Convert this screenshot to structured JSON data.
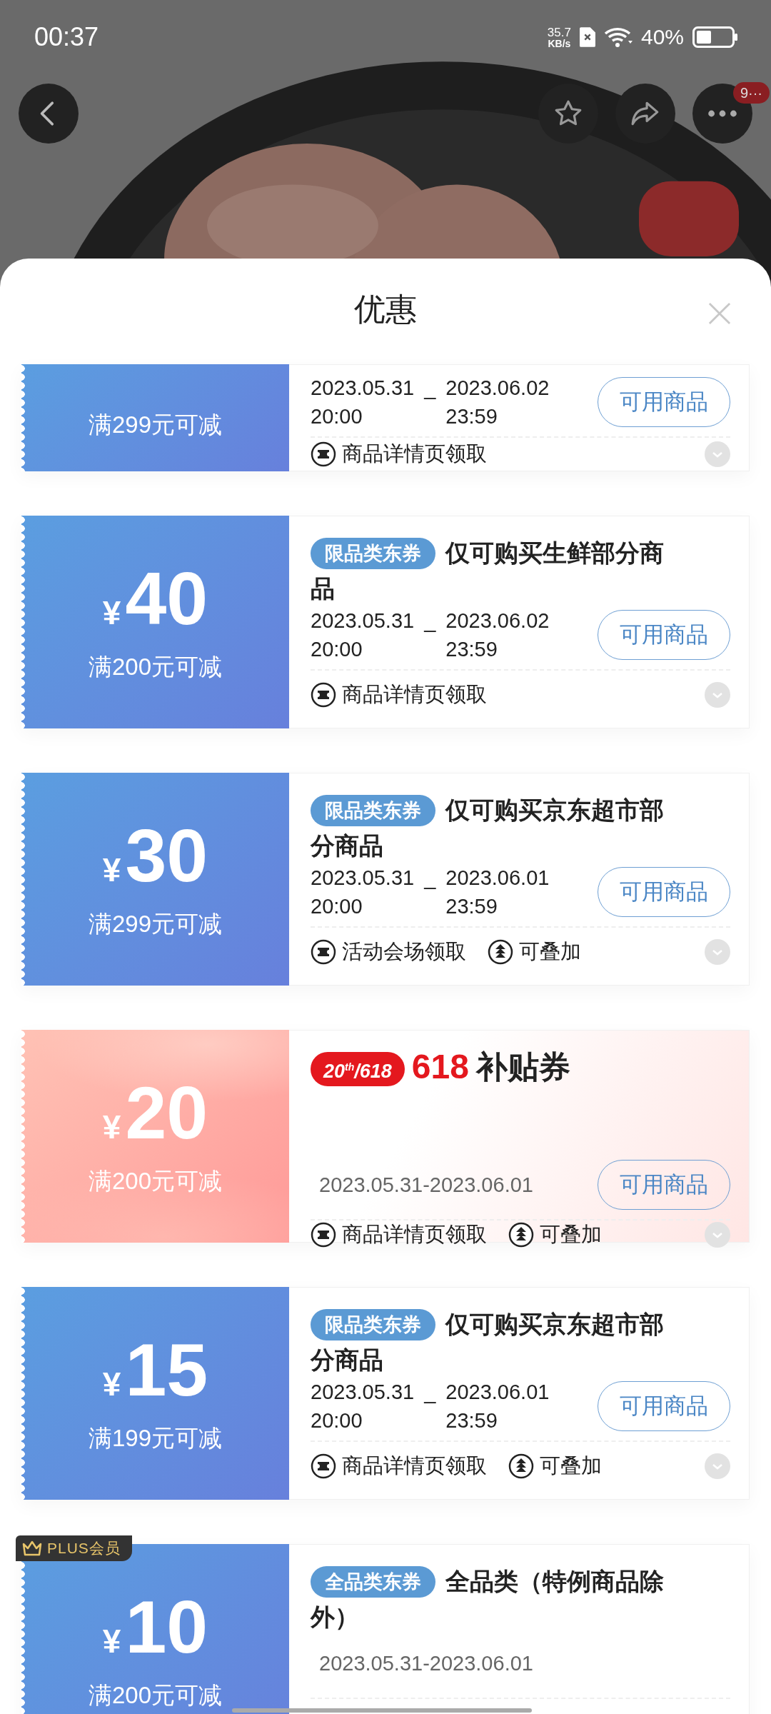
{
  "status_bar": {
    "time": "00:37",
    "net_speed": "35.7",
    "net_unit": "KB/s",
    "battery": "40%"
  },
  "top_bar": {
    "badge": "9···"
  },
  "sheet": {
    "title": "优惠"
  },
  "coupons": [
    {
      "kind": "standard",
      "condition": "满299元可减",
      "dates": {
        "kind": "range",
        "start_date": "2023.05.31",
        "start_time": "20:00",
        "separator": "_",
        "end_date": "2023.06.02",
        "end_time": "23:59"
      },
      "button": "可用商品",
      "footer": [
        {
          "kind": "source",
          "text": "商品详情页领取"
        }
      ]
    },
    {
      "kind": "standard",
      "currency": "¥",
      "amount": "40",
      "condition": "满200元可减",
      "tag": "限品类东券",
      "title": "仅可购买生鲜部分商品",
      "dates": {
        "kind": "range",
        "start_date": "2023.05.31",
        "start_time": "20:00",
        "separator": "_",
        "end_date": "2023.06.02",
        "end_time": "23:59"
      },
      "button": "可用商品",
      "footer": [
        {
          "kind": "source",
          "text": "商品详情页领取"
        }
      ]
    },
    {
      "kind": "standard",
      "currency": "¥",
      "amount": "30",
      "condition": "满299元可减",
      "tag": "限品类东券",
      "title": "仅可购买京东超市部分商品",
      "dates": {
        "kind": "range",
        "start_date": "2023.05.31",
        "start_time": "20:00",
        "separator": "_",
        "end_date": "2023.06.01",
        "end_time": "23:59"
      },
      "button": "可用商品",
      "footer": [
        {
          "kind": "source",
          "text": "活动会场领取"
        },
        {
          "kind": "stackable",
          "text": "可叠加"
        }
      ]
    },
    {
      "kind": "subsidy",
      "currency": "¥",
      "amount": "20",
      "condition": "满200元可减",
      "badge": "20$^{th}$/618",
      "accent": "618",
      "title": "补贴券",
      "dates": {
        "kind": "single",
        "text": "2023.05.31-2023.06.01"
      },
      "button": "可用商品",
      "footer": [
        {
          "kind": "source",
          "text": "商品详情页领取"
        },
        {
          "kind": "stackable",
          "text": "可叠加"
        }
      ]
    },
    {
      "kind": "standard",
      "currency": "¥",
      "amount": "15",
      "condition": "满199元可减",
      "tag": "限品类东券",
      "title": "仅可购买京东超市部分商品",
      "dates": {
        "kind": "range",
        "start_date": "2023.05.31",
        "start_time": "20:00",
        "separator": "_",
        "end_date": "2023.06.01",
        "end_time": "23:59"
      },
      "button": "可用商品",
      "footer": [
        {
          "kind": "source",
          "text": "商品详情页领取"
        },
        {
          "kind": "stackable",
          "text": "可叠加"
        }
      ]
    },
    {
      "kind": "standard",
      "member_badge": "PLUS会员",
      "currency": "¥",
      "amount": "10",
      "condition": "满200元可减",
      "tag": "全品类东券",
      "title": "全品类（特例商品除外）",
      "dates": {
        "kind": "single",
        "text": "2023.05.31-2023.06.01"
      }
    }
  ]
}
